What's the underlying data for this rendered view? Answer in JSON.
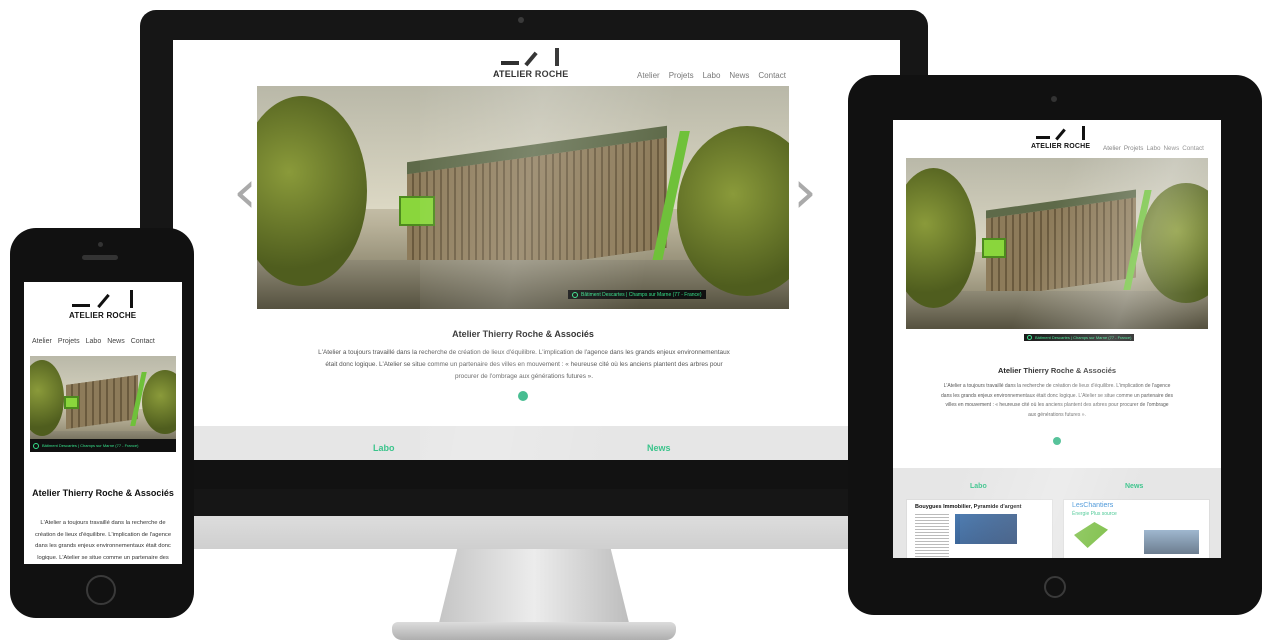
{
  "brand": {
    "name": "ATELIER ROCHE"
  },
  "nav": [
    "Atelier",
    "Projets",
    "Labo",
    "News",
    "Contact"
  ],
  "hero": {
    "caption": "Bâtiment Descartes | Champs sur Marne (77 - France)"
  },
  "intro": {
    "title": "Atelier Thierry Roche & Associés",
    "text": "L'Atelier a toujours travaillé dans la recherche de création de lieux d'équilibre. L'implication de l'agence dans les grands enjeux environnementaux était donc logique. L'Atelier se situe comme un partenaire des villes en mouvement : « heureuse cité où les anciens plantent des arbres pour procurer de l'ombrage aux générations futures »."
  },
  "sections": {
    "labo": "Labo",
    "news": "News"
  },
  "tablet_thumbs": {
    "labo_title": "Bouygues Immobilier, Pyramide d'argent",
    "news_title": "LesChantiers",
    "news_sub": "Énergie Plus source"
  },
  "slider": {
    "prev": "‹",
    "next": "›"
  },
  "colors": {
    "accent": "#3cc48c",
    "caption_text": "#35e08a",
    "band": "#e6e6e6"
  }
}
